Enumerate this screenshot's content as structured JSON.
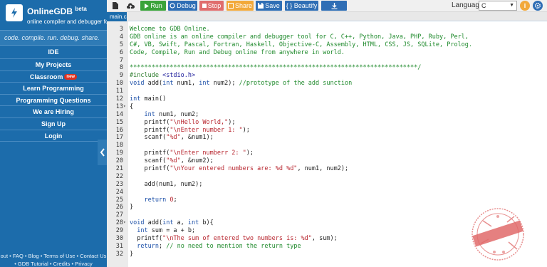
{
  "brand": {
    "name": "OnlineGDB",
    "beta": "beta",
    "subtitle": "online compiler and debugger for c/c++"
  },
  "tagline": "code. compile. run. debug. share.",
  "nav": {
    "ide": "IDE",
    "my_projects": "My Projects",
    "classroom": "Classroom",
    "classroom_badge": "new",
    "learn_programming": "Learn Programming",
    "programming_questions": "Programming Questions",
    "we_are_hiring": "We are Hiring",
    "sign_up": "Sign Up",
    "login": "Login"
  },
  "footer": {
    "line1": "out • FAQ • Blog • Terms of Use • Contact Us",
    "line2": "• GDB Tutorial • Credits • Privacy"
  },
  "toolbar": {
    "run": "Run",
    "debug": "Debug",
    "stop": "Stop",
    "share": "Share",
    "save": "Save",
    "beautify": "{ } Beautify",
    "language_label": "Language",
    "language_value": "C"
  },
  "tab": {
    "label": "main.c"
  },
  "colors": {
    "sidebar": "#1c6cab",
    "run": "#3aa33a",
    "debug": "#2f6eb5",
    "stop": "#e06d6d",
    "share": "#f2a93b",
    "save": "#2f6eb5",
    "beautify": "#2f6eb5",
    "upload": "#2f6eb5",
    "help": "#f2a93b"
  },
  "code": {
    "ln3": "3",
    "ln4": "4",
    "ln5": "5",
    "ln6": "6",
    "ln7": "7",
    "ln8": "8",
    "ln9": "9",
    "ln10": "10",
    "ln11": "11",
    "ln12": "12",
    "ln13": "13",
    "ln14": "14",
    "ln15": "15",
    "ln16": "16",
    "ln17": "17",
    "ln18": "18",
    "ln19": "19",
    "ln20": "20",
    "ln21": "21",
    "ln22": "22",
    "ln23": "23",
    "ln24": "24",
    "ln25": "25",
    "ln26": "26",
    "ln27": "27",
    "ln28": "28",
    "ln29": "29",
    "ln30": "30",
    "ln31": "31",
    "ln32": "32",
    "c3": "Welcome to GDB Online.",
    "c4": "GDB online is an online compiler and debugger tool for C, C++, Python, Java, PHP, Ruby, Perl,",
    "c5": "C#, VB, Swift, Pascal, Fortran, Haskell, Objective-C, Assembly, HTML, CSS, JS, SQLite, Prolog.",
    "c6": "Code, Compile, Run and Debug online from anywhere in world.",
    "c8": "*******************************************************************************/",
    "c9_dir": "#include",
    "c9_inc": " <stdio.h>",
    "c10_kw1": "void",
    "c10_a": " add(",
    "c10_kw2": "int",
    "c10_b": " num1, ",
    "c10_kw3": "int",
    "c10_c": " num2); ",
    "c10_com": "//prototype of the add sunction",
    "c12_kw": "int",
    "c12_rest": " main()",
    "c13": "{",
    "c14_kw": "int",
    "c14_rest": " num1, num2;",
    "c15_a": "printf(",
    "c15_str": "\"\\nHello World,\"",
    "c15_b": ");",
    "c16_a": "printf(",
    "c16_str": "\"\\nEnter number 1: \"",
    "c16_b": ");",
    "c17_a": "scanf(",
    "c17_str": "\"%d\"",
    "c17_b": ", &num1);",
    "c19_a": "printf(",
    "c19_str": "\"\\nEnter numberr 2: \"",
    "c19_b": ");",
    "c20_a": "scanf(",
    "c20_str": "\"%d\"",
    "c20_b": ", &num2);",
    "c21_a": "printf(",
    "c21_str": "\"\\nYour entered numbers are: %d %d\"",
    "c21_b": ", num1, num2);",
    "c23": "add(num1, num2);",
    "c25_kw": "return",
    "c25_num": "0",
    "c25_b": ";",
    "c26": "}",
    "c28_kw1": "void",
    "c28_a": " add(",
    "c28_kw2": "int",
    "c28_b": " a, ",
    "c28_kw3": "int",
    "c28_c": " b){",
    "c29_kw": "int",
    "c29_rest": " sum = a + b;",
    "c30_a": "printf(",
    "c30_str": "\"\\nThe sum of entered two numbers is: %d\"",
    "c30_b": ", sum);",
    "c31_kw": "return",
    "c31_b": "; ",
    "c31_com": "// no need to mention the return type",
    "c32": "}"
  }
}
